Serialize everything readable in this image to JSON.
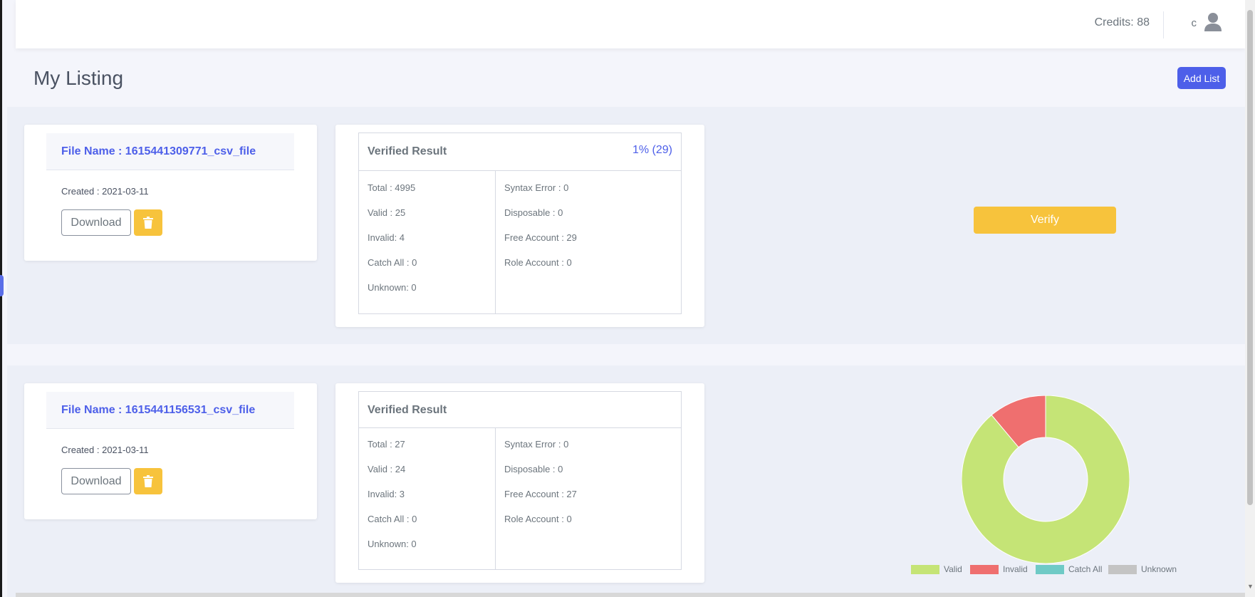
{
  "header": {
    "credits_label": "Credits: 88",
    "user_initial": "c"
  },
  "page": {
    "title": "My Listing",
    "add_list_label": "Add List"
  },
  "listings": [
    {
      "file_name": "File Name : 1615441309771_csv_file",
      "created": "Created : 2021-03-11",
      "download_label": "Download",
      "result_title": "Verified Result",
      "progress": "1% (29)",
      "stats_left": [
        "Total : 4995",
        "Valid : 25",
        "Invalid: 4",
        "Catch All : 0",
        "Unknown: 0"
      ],
      "stats_right": [
        "Syntax Error : 0",
        "Disposable : 0",
        "Free Account : 29",
        "Role Account : 0"
      ],
      "action_label": "Verify"
    },
    {
      "file_name": "File Name : 1615441156531_csv_file",
      "created": "Created : 2021-03-11",
      "download_label": "Download",
      "result_title": "Verified Result",
      "stats_left": [
        "Total : 27",
        "Valid : 24",
        "Invalid: 3",
        "Catch All : 0",
        "Unknown: 0"
      ],
      "stats_right": [
        "Syntax Error : 0",
        "Disposable : 0",
        "Free Account : 27",
        "Role Account : 0"
      ]
    }
  ],
  "chart_data": {
    "type": "pie",
    "donut": true,
    "categories": [
      "Valid",
      "Invalid",
      "Catch All",
      "Unknown"
    ],
    "values": [
      24,
      3,
      0,
      0
    ],
    "colors": [
      "#c5e476",
      "#ef6f6f",
      "#6fcac6",
      "#c4c4c4"
    ],
    "legend_position": "bottom"
  },
  "icons": {
    "user": "user-icon",
    "trash": "trash-icon"
  },
  "colors": {
    "primary": "#4d5fe9",
    "warning": "#f7c33c",
    "row_background": "#eceff7"
  }
}
